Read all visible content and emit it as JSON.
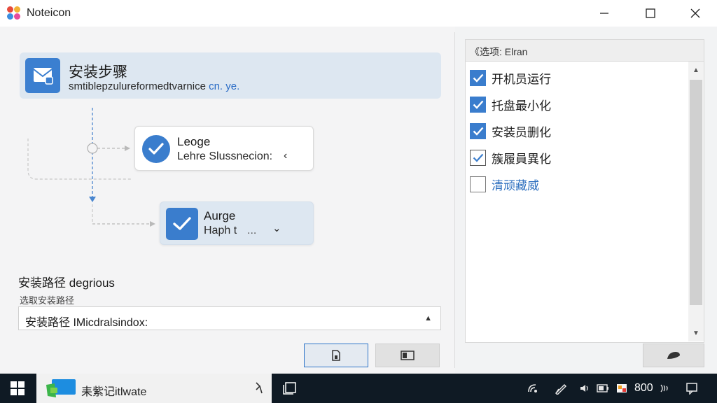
{
  "window": {
    "title": "Noteicon"
  },
  "wizard": {
    "header_title": "安装步骤",
    "header_subtitle": "smtiblepzulureformedtvarnice",
    "header_subtitle_link": "cn. ye.",
    "steps": [
      {
        "title": "Leoge",
        "subtitle": "Lehre Slussnecion:",
        "chevron": "‹"
      },
      {
        "title": "Aurge",
        "subtitle": "Haph t",
        "dots": "...",
        "chevron": "⌄"
      }
    ],
    "install_path": {
      "label": "安装路径 degrious",
      "hint": "选取安装路径",
      "value": "安装路径 IMicdralsindox:"
    }
  },
  "options": {
    "header": "《选项: Elran",
    "items": [
      {
        "label": "开机员运行",
        "checked": true
      },
      {
        "label": "托盘最小化",
        "checked": true
      },
      {
        "label": "安装员删化",
        "checked": true
      },
      {
        "label": "簇履員異化",
        "checked": true,
        "style": "light"
      },
      {
        "label": "清顽藏威",
        "checked": false,
        "style": "link"
      }
    ]
  },
  "taskbar": {
    "search_text": "耒紫记itlwate",
    "clock": "800"
  },
  "colors": {
    "accent": "#3a7dcd",
    "header_bg": "#dde7f1",
    "taskbar_bg": "#0f1a24"
  },
  "icons": [
    "app-logo",
    "minimize-icon",
    "maximize-icon",
    "close-icon",
    "mail-icon",
    "check-icon",
    "chevron-down-icon",
    "scroll-up-icon",
    "scroll-down-icon",
    "windows-start-icon",
    "mic-icon",
    "task-view-icon",
    "network-icon",
    "pen-icon",
    "volume-icon",
    "battery-icon",
    "flag-icon",
    "notification-icon"
  ]
}
